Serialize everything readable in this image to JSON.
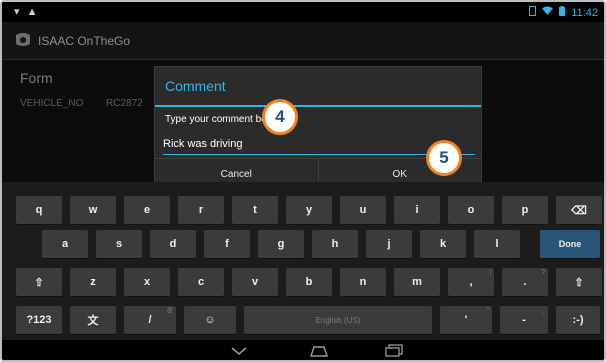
{
  "status_bar": {
    "left_icons": "▾ ▲",
    "time": "11:42"
  },
  "app": {
    "title": "ISAAC OnTheGo",
    "form_title": "Form",
    "field_label": "VEHICLE_NO",
    "field_value": "RC2872"
  },
  "dialog": {
    "title": "Comment",
    "message": "Type your comment below.",
    "input_value": "Rick was driving",
    "cancel_label": "Cancel",
    "ok_label": "OK"
  },
  "callouts": [
    "4",
    "5"
  ],
  "keyboard": {
    "row1": [
      "q",
      "w",
      "e",
      "r",
      "t",
      "y",
      "u",
      "i",
      "o",
      "p",
      "⌫"
    ],
    "row2": [
      "a",
      "s",
      "d",
      "f",
      "g",
      "h",
      "j",
      "k",
      "l",
      "Done"
    ],
    "row3": [
      "⇧",
      "z",
      "x",
      "c",
      "v",
      "b",
      "n",
      "m",
      ",",
      ".",
      "⇧"
    ],
    "row3_subs": [
      "",
      "",
      "",
      "",
      "",
      "",
      "",
      "",
      "!",
      "?",
      ""
    ],
    "row4": [
      "?123",
      "文",
      "/",
      "☺",
      "English (US)",
      "'",
      "-",
      ":-)"
    ],
    "row4_subs": [
      "",
      "",
      "@",
      "",
      "",
      "\"",
      "_",
      ""
    ]
  },
  "colors": {
    "accent": "#33b5e5",
    "callout_border": "#f58220",
    "callout_text": "#1f4f82",
    "done_key": "#2a5576"
  }
}
